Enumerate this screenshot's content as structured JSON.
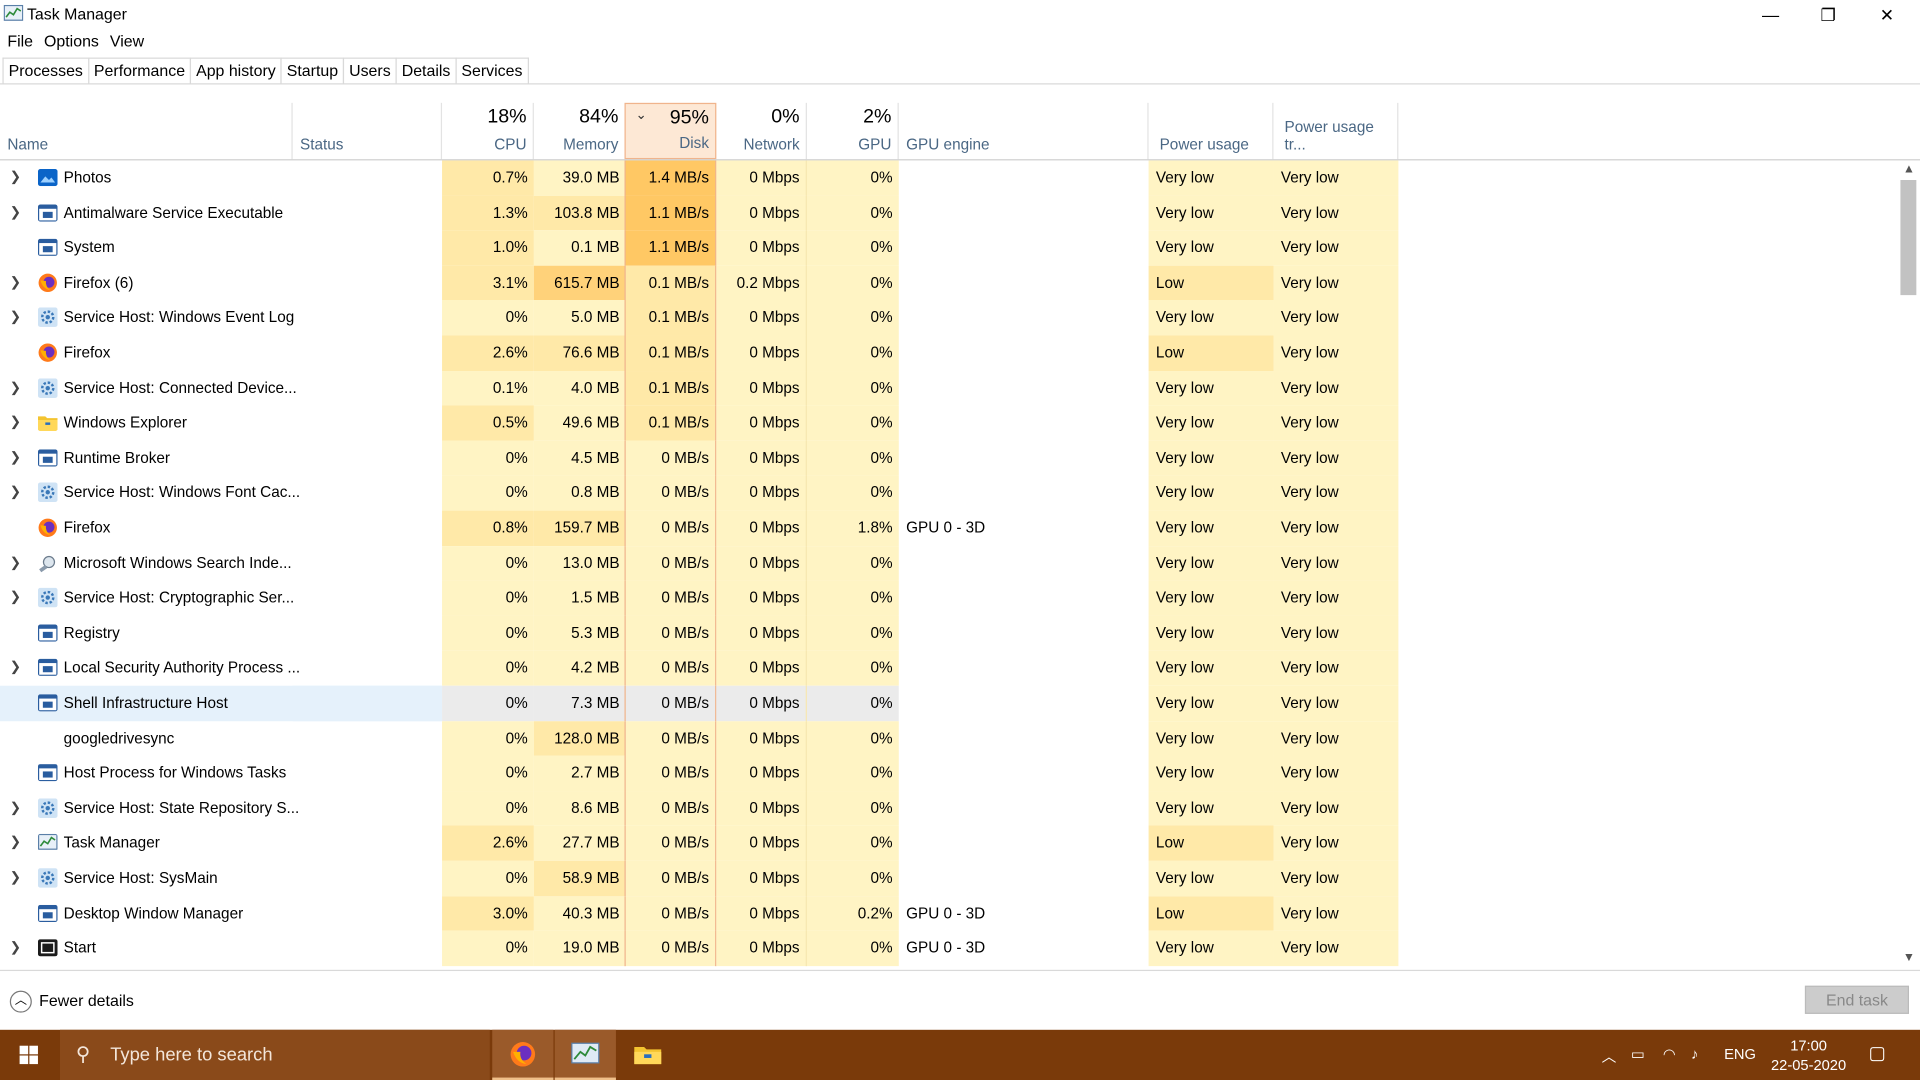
{
  "window": {
    "title": "Task Manager",
    "controls": {
      "minimize": "—",
      "restore": "❐",
      "close": "✕"
    }
  },
  "menu": [
    "File",
    "Options",
    "View"
  ],
  "tabs": [
    "Processes",
    "Performance",
    "App history",
    "Startup",
    "Users",
    "Details",
    "Services"
  ],
  "headers": {
    "name": "Name",
    "status": "Status",
    "cpu": {
      "pct": "18%",
      "label": "CPU"
    },
    "memory": {
      "pct": "84%",
      "label": "Memory"
    },
    "disk": {
      "pct": "95%",
      "label": "Disk"
    },
    "network": {
      "pct": "0%",
      "label": "Network"
    },
    "gpu": {
      "pct": "2%",
      "label": "GPU"
    },
    "gpu_engine": "GPU engine",
    "power": "Power usage",
    "power_trend": "Power usage tr..."
  },
  "processes": [
    {
      "name": "Photos",
      "expand": true,
      "icon": "photos-icon",
      "cpu": "0.7%",
      "mem": "39.0 MB",
      "disk": "1.4 MB/s",
      "net": "0 Mbps",
      "gpu": "0%",
      "engine": "",
      "power": "Very low",
      "trend": "Very low"
    },
    {
      "name": "Antimalware Service Executable",
      "expand": true,
      "icon": "app-window-icon",
      "cpu": "1.3%",
      "mem": "103.8 MB",
      "disk": "1.1 MB/s",
      "net": "0 Mbps",
      "gpu": "0%",
      "engine": "",
      "power": "Very low",
      "trend": "Very low"
    },
    {
      "name": "System",
      "expand": false,
      "icon": "app-window-icon",
      "cpu": "1.0%",
      "mem": "0.1 MB",
      "disk": "1.1 MB/s",
      "net": "0 Mbps",
      "gpu": "0%",
      "engine": "",
      "power": "Very low",
      "trend": "Very low"
    },
    {
      "name": "Firefox (6)",
      "expand": true,
      "icon": "firefox-icon",
      "cpu": "3.1%",
      "mem": "615.7 MB",
      "disk": "0.1 MB/s",
      "net": "0.2 Mbps",
      "gpu": "0%",
      "engine": "",
      "power": "Low",
      "trend": "Very low"
    },
    {
      "name": "Service Host: Windows Event Log",
      "expand": true,
      "icon": "gear-icon",
      "cpu": "0%",
      "mem": "5.0 MB",
      "disk": "0.1 MB/s",
      "net": "0 Mbps",
      "gpu": "0%",
      "engine": "",
      "power": "Very low",
      "trend": "Very low"
    },
    {
      "name": "Firefox",
      "expand": false,
      "icon": "firefox-icon",
      "cpu": "2.6%",
      "mem": "76.6 MB",
      "disk": "0.1 MB/s",
      "net": "0 Mbps",
      "gpu": "0%",
      "engine": "",
      "power": "Low",
      "trend": "Very low"
    },
    {
      "name": "Service Host: Connected Device...",
      "expand": true,
      "icon": "gear-icon",
      "cpu": "0.1%",
      "mem": "4.0 MB",
      "disk": "0.1 MB/s",
      "net": "0 Mbps",
      "gpu": "0%",
      "engine": "",
      "power": "Very low",
      "trend": "Very low"
    },
    {
      "name": "Windows Explorer",
      "expand": true,
      "icon": "folder-icon",
      "cpu": "0.5%",
      "mem": "49.6 MB",
      "disk": "0.1 MB/s",
      "net": "0 Mbps",
      "gpu": "0%",
      "engine": "",
      "power": "Very low",
      "trend": "Very low"
    },
    {
      "name": "Runtime Broker",
      "expand": true,
      "icon": "app-window-icon",
      "cpu": "0%",
      "mem": "4.5 MB",
      "disk": "0 MB/s",
      "net": "0 Mbps",
      "gpu": "0%",
      "engine": "",
      "power": "Very low",
      "trend": "Very low"
    },
    {
      "name": "Service Host: Windows Font Cac...",
      "expand": true,
      "icon": "gear-icon",
      "cpu": "0%",
      "mem": "0.8 MB",
      "disk": "0 MB/s",
      "net": "0 Mbps",
      "gpu": "0%",
      "engine": "",
      "power": "Very low",
      "trend": "Very low"
    },
    {
      "name": "Firefox",
      "expand": false,
      "icon": "firefox-icon",
      "cpu": "0.8%",
      "mem": "159.7 MB",
      "disk": "0 MB/s",
      "net": "0 Mbps",
      "gpu": "1.8%",
      "engine": "GPU 0 - 3D",
      "power": "Very low",
      "trend": "Very low"
    },
    {
      "name": "Microsoft Windows Search Inde...",
      "expand": true,
      "icon": "search-indexer-icon",
      "cpu": "0%",
      "mem": "13.0 MB",
      "disk": "0 MB/s",
      "net": "0 Mbps",
      "gpu": "0%",
      "engine": "",
      "power": "Very low",
      "trend": "Very low"
    },
    {
      "name": "Service Host: Cryptographic Ser...",
      "expand": true,
      "icon": "gear-icon",
      "cpu": "0%",
      "mem": "1.5 MB",
      "disk": "0 MB/s",
      "net": "0 Mbps",
      "gpu": "0%",
      "engine": "",
      "power": "Very low",
      "trend": "Very low"
    },
    {
      "name": "Registry",
      "expand": false,
      "icon": "app-window-icon",
      "cpu": "0%",
      "mem": "5.3 MB",
      "disk": "0 MB/s",
      "net": "0 Mbps",
      "gpu": "0%",
      "engine": "",
      "power": "Very low",
      "trend": "Very low"
    },
    {
      "name": "Local Security Authority Process ...",
      "expand": true,
      "icon": "app-window-icon",
      "cpu": "0%",
      "mem": "4.2 MB",
      "disk": "0 MB/s",
      "net": "0 Mbps",
      "gpu": "0%",
      "engine": "",
      "power": "Very low",
      "trend": "Very low"
    },
    {
      "name": "Shell Infrastructure Host",
      "expand": false,
      "icon": "app-window-icon",
      "cpu": "0%",
      "mem": "7.3 MB",
      "disk": "0 MB/s",
      "net": "0 Mbps",
      "gpu": "0%",
      "engine": "",
      "power": "Very low",
      "trend": "Very low",
      "selected": true
    },
    {
      "name": "googledrivesync",
      "expand": false,
      "icon": "",
      "cpu": "0%",
      "mem": "128.0 MB",
      "disk": "0 MB/s",
      "net": "0 Mbps",
      "gpu": "0%",
      "engine": "",
      "power": "Very low",
      "trend": "Very low"
    },
    {
      "name": "Host Process for Windows Tasks",
      "expand": false,
      "icon": "app-window-icon",
      "cpu": "0%",
      "mem": "2.7 MB",
      "disk": "0 MB/s",
      "net": "0 Mbps",
      "gpu": "0%",
      "engine": "",
      "power": "Very low",
      "trend": "Very low"
    },
    {
      "name": "Service Host: State Repository S...",
      "expand": true,
      "icon": "gear-icon",
      "cpu": "0%",
      "mem": "8.6 MB",
      "disk": "0 MB/s",
      "net": "0 Mbps",
      "gpu": "0%",
      "engine": "",
      "power": "Very low",
      "trend": "Very low"
    },
    {
      "name": "Task Manager",
      "expand": true,
      "icon": "task-manager-icon",
      "cpu": "2.6%",
      "mem": "27.7 MB",
      "disk": "0 MB/s",
      "net": "0 Mbps",
      "gpu": "0%",
      "engine": "",
      "power": "Low",
      "trend": "Very low"
    },
    {
      "name": "Service Host: SysMain",
      "expand": true,
      "icon": "gear-icon",
      "cpu": "0%",
      "mem": "58.9 MB",
      "disk": "0 MB/s",
      "net": "0 Mbps",
      "gpu": "0%",
      "engine": "",
      "power": "Very low",
      "trend": "Very low"
    },
    {
      "name": "Desktop Window Manager",
      "expand": false,
      "icon": "app-window-icon",
      "cpu": "3.0%",
      "mem": "40.3 MB",
      "disk": "0 MB/s",
      "net": "0 Mbps",
      "gpu": "0.2%",
      "engine": "GPU 0 - 3D",
      "power": "Low",
      "trend": "Very low"
    },
    {
      "name": "Start",
      "expand": true,
      "icon": "start-app-icon",
      "cpu": "0%",
      "mem": "19.0 MB",
      "disk": "0 MB/s",
      "net": "0 Mbps",
      "gpu": "0%",
      "engine": "GPU 0 - 3D",
      "power": "Very low",
      "trend": "Very low"
    }
  ],
  "footer": {
    "fewer_details": "Fewer details",
    "end_task": "End task"
  },
  "taskbar": {
    "search_placeholder": "Type here to search",
    "language": "ENG",
    "time": "17:00",
    "date": "22-05-2020"
  },
  "colors": {
    "heat_light": "#fff4c4",
    "heat_mid": "#ffe9a8",
    "heat_strong": "#ffd27a",
    "heat_disk_hi": "#ffc864",
    "selected_row": "#e5f1fb",
    "taskbar": "#7a3a0a"
  }
}
